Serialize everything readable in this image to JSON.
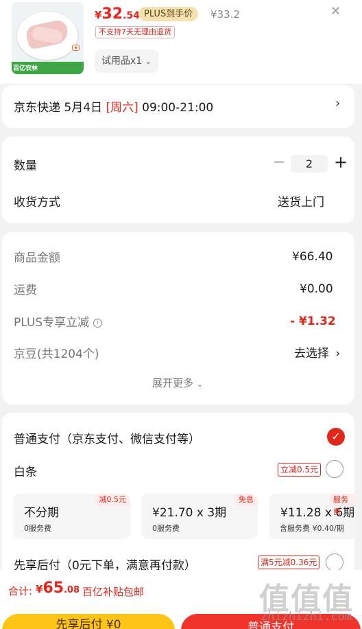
{
  "product": {
    "brand_label": "百亿农林",
    "price_currency": "¥",
    "price_int": "32",
    "price_dec": ".54",
    "plus_badge": "PLUS到手价",
    "original_price": "¥33.2",
    "close_glyph": "✕",
    "no_return": "不支持7天无理由退货",
    "spec": "试用品x1",
    "spec_chevron": "⌄"
  },
  "delivery": {
    "carrier": "京东快递 5月4日 ",
    "weekday": "[周六]",
    "time": " 09:00-21:00",
    "chevron": "›"
  },
  "quantity": {
    "label": "数量",
    "minus": "−",
    "value": "2",
    "plus": "+",
    "receive_label": "收货方式",
    "receive_value": "送货上门"
  },
  "amounts": {
    "goods_label": "商品金额",
    "goods_value": "¥66.40",
    "shipping_label": "运费",
    "shipping_value": "¥0.00",
    "plus_label": "PLUS专享立减",
    "plus_info": "i",
    "plus_value": "- ¥1.32",
    "beans_label": "京豆(共1204个)",
    "beans_action": "去选择",
    "beans_chevron": "›",
    "expand_label": "展开更多",
    "expand_chevron": "⌄"
  },
  "payment": {
    "normal_label": "普通支付（京东支付、微信支付等）",
    "normal_check": "✓",
    "baitiao_label": "白条",
    "baitiao_promo": "立减0.5元",
    "installments": [
      {
        "title": "不分期",
        "sub": "0服务费",
        "corner": "减0.5元"
      },
      {
        "title": "¥21.70 x 3期",
        "sub": "0服务费",
        "corner": "免息"
      },
      {
        "title": "¥11.28 x 6期",
        "sub": "含服务费 ¥0.40/期",
        "corner": "服务费"
      }
    ],
    "later_label": "先享后付（0元下单，满意再付款）",
    "later_promo": "满5元减0.36元"
  },
  "bottom": {
    "total_label": "合计:",
    "total_currency": "¥",
    "total_int": "65",
    "total_dec": ".08",
    "subsidy": "百亿补贴包邮",
    "btn_later": "先享后付 ¥0",
    "btn_pay": "普通支付"
  },
  "watermark": {
    "glyphs": "值值值",
    "text": "zhizhizhi.com"
  },
  "colors": {
    "accent": "#e4251c",
    "plus_gold": "#f6e2b0",
    "later_button": "#ffc515",
    "pay_button": "#f0342b"
  }
}
